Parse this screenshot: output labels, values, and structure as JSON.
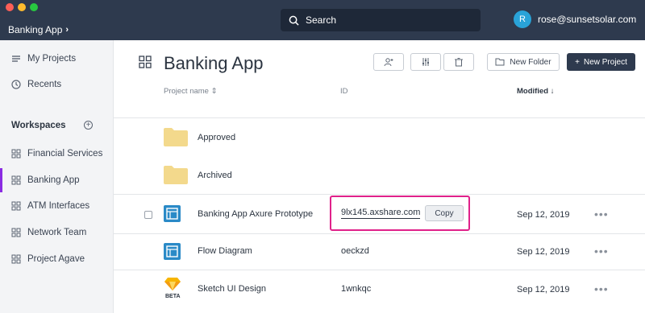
{
  "topbar": {
    "breadcrumb": "Banking App",
    "search_placeholder": "Search",
    "user_initial": "R",
    "user_email": "rose@sunsetsolar.com"
  },
  "sidebar": {
    "my_projects": "My Projects",
    "recents": "Recents",
    "workspaces_title": "Workspaces",
    "workspaces": [
      {
        "label": "Financial Services"
      },
      {
        "label": "Banking App"
      },
      {
        "label": "ATM Interfaces"
      },
      {
        "label": "Network Team"
      },
      {
        "label": "Project Agave"
      }
    ],
    "active_workspace": "Banking App",
    "accent": "#8a2be2"
  },
  "main": {
    "title": "Banking App",
    "new_folder": "New Folder",
    "new_project": "New Project",
    "columns": {
      "name": "Project name",
      "id": "ID",
      "modified": "Modified"
    },
    "folders": [
      {
        "name": "Approved"
      },
      {
        "name": "Archived"
      }
    ],
    "projects": [
      {
        "name": "Banking App Axure Prototype",
        "id": "9lx145.axshare.com",
        "modified": "Sep 12, 2019",
        "copy_label": "Copy"
      },
      {
        "name": "Flow Diagram",
        "id": "oeckzd",
        "modified": "Sep 12, 2019"
      },
      {
        "name": "Sketch UI Design",
        "id": "1wnkqc",
        "modified": "Sep 12, 2019",
        "badge": "BETA"
      }
    ],
    "more_label": "•••",
    "highlight_color": "#e0218a"
  }
}
